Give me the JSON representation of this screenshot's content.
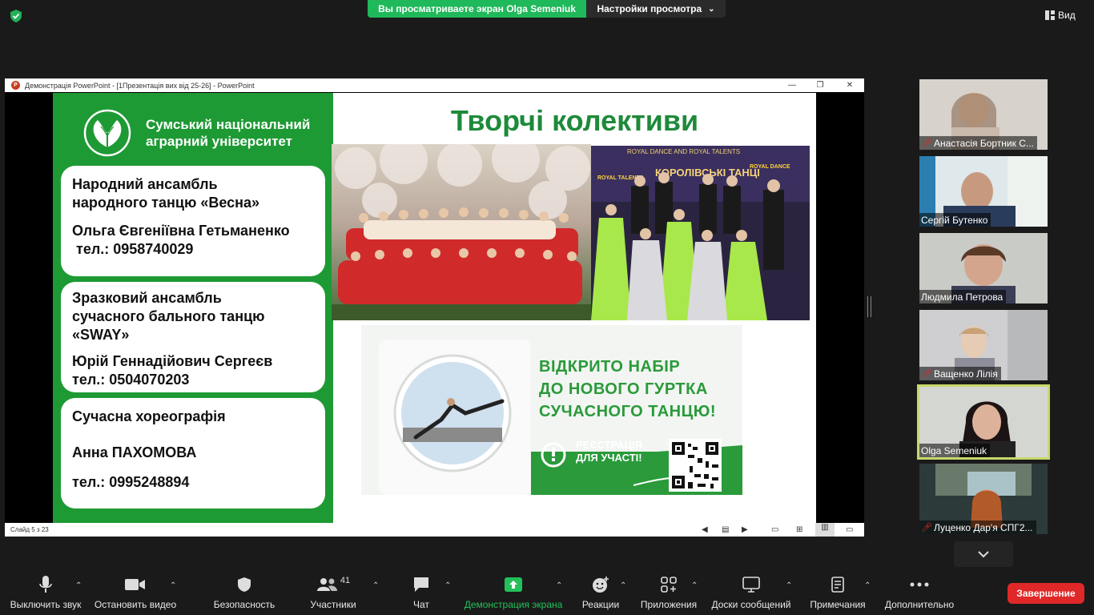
{
  "top": {
    "share_banner": "Вы просматриваете экран Olga Semeniuk",
    "view_settings": "Настройки просмотра",
    "view_button": "Вид"
  },
  "ppt": {
    "window_title": "Демонстрація PowerPoint - [1Презентація вих від 25-26] - PowerPoint",
    "status": "Слайд 5 з 23"
  },
  "slide": {
    "university": [
      "Сумський національний",
      "аграрний університет"
    ],
    "title": "Творчі колективи",
    "cards": [
      {
        "lines": [
          "Народний ансамбль",
          "народного танцю «Весна»"
        ],
        "person": "Ольга Євгеніївна Гетьманенко",
        "phone": " тел.: 0958740029"
      },
      {
        "lines": [
          "Зразковий ансамбль",
          "сучасного бального танцю",
          "«SWAY»"
        ],
        "person": "Юрій Геннадійович Сергеєв",
        "phone": "тел.: 0504070203"
      },
      {
        "lines": [
          "Сучасна хореографія"
        ],
        "person": "Анна ПАХОМОВА",
        "phone": "тел.: 0995248894"
      }
    ],
    "banner": {
      "headline": [
        "ВІДКРИТО НАБІР",
        "ДО НОВОГО ГУРТКА",
        "СУЧАСНОГО ТАНЦЮ!"
      ],
      "registration": [
        "РЕЄСТРАЦІЯ",
        "ДЛЯ УЧАСТІ!"
      ]
    },
    "photo2_text": [
      "ROYAL DANCE AND ROYAL TALENTS",
      "КОРОЛІВСЬКІ ТАНЦІ",
      "ROYAL TALENTS",
      "ROYAL DANCE"
    ]
  },
  "participants": [
    {
      "name": "Анастасія Бортник С...",
      "muted": true
    },
    {
      "name": "Сергій Бутенко",
      "muted": false
    },
    {
      "name": "Людмила Петрова",
      "muted": false
    },
    {
      "name": "Ващенко Лілія",
      "muted": true
    },
    {
      "name": "Olga Semeniuk",
      "muted": false
    },
    {
      "name": "Луценко Дар'я СПГ2...",
      "muted": true
    }
  ],
  "toolbar": {
    "mute": "Выключить звук",
    "video": "Остановить видео",
    "security": "Безопасность",
    "participants": "Участники",
    "participants_count": "41",
    "chat": "Чат",
    "share": "Демонстрация экрана",
    "reactions": "Реакции",
    "apps": "Приложения",
    "whiteboards": "Доски сообщений",
    "notes": "Примечания",
    "more": "Дополнительно",
    "end": "Завершение"
  }
}
